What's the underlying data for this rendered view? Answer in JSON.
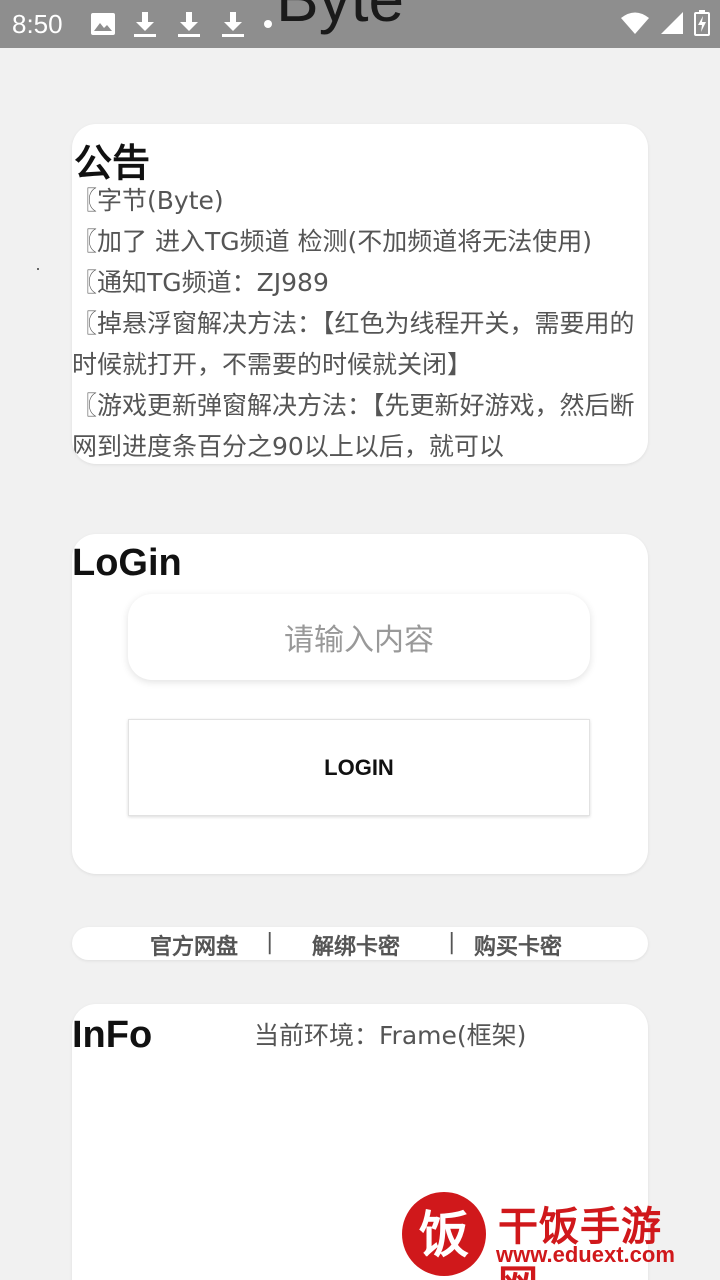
{
  "status_bar": {
    "time": "8:50",
    "left_icons": [
      "image-icon",
      "download-icon",
      "download-icon",
      "download-icon",
      "dot-icon"
    ],
    "right_icons": [
      "wifi-icon",
      "signal-icon",
      "battery-icon"
    ]
  },
  "header": {
    "title_peek": "Byte"
  },
  "notice": {
    "title": "公告",
    "lines": [
      "〖字节(Byte)",
      "〖加了 进入TG频道 检测(不加频道将无法使用)",
      "〖通知TG频道：ZJ989",
      "〖掉悬浮窗解决方法：【红色为线程开关，需要用的时候就打开，不需要的时候就关闭】",
      "〖游戏更新弹窗解决方法：【先更新好游戏，然后断网到进度条百分之90以上以后，就可以"
    ]
  },
  "login": {
    "title": "LoGin",
    "input_placeholder": "请输入内容",
    "button_label": "LOGIN"
  },
  "links": {
    "official_disk": "官方网盘",
    "unbind_card": "解绑卡密",
    "buy_card": "购买卡密",
    "separator": "|"
  },
  "info": {
    "title": "InFo",
    "environment": "当前环境：Frame(框架)"
  },
  "watermark": {
    "logo_char": "饭",
    "site_name": "干饭手游网",
    "url": "www.eduext.com"
  },
  "colors": {
    "status_bar_bg": "#8e8e8e",
    "page_bg": "#f1f1f1",
    "card_bg": "#ffffff",
    "watermark_red": "#d0181b"
  }
}
